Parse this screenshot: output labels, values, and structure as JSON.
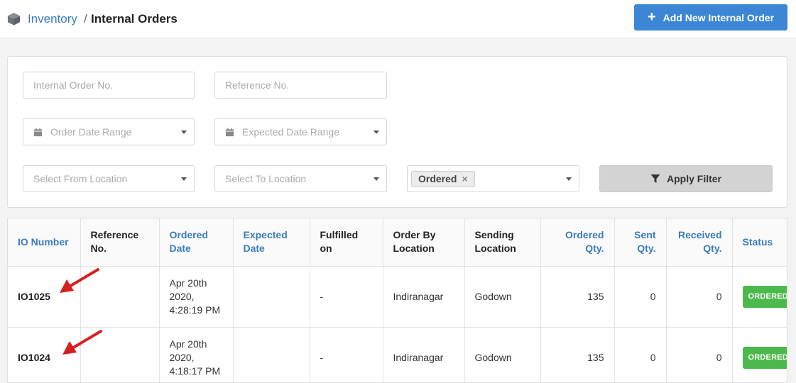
{
  "header": {
    "breadcrumb_root": "Inventory",
    "breadcrumb_separator": "/",
    "breadcrumb_current": "Internal Orders",
    "add_button_label": "Add New Internal Order",
    "breadcrumb_icon": "box-icon",
    "add_icon": "plus-icon"
  },
  "filters": {
    "io_number_placeholder": "Internal Order No.",
    "reference_placeholder": "Reference No.",
    "order_date_placeholder": "Order Date Range",
    "expected_date_placeholder": "Expected Date Range",
    "from_location_placeholder": "Select From Location",
    "to_location_placeholder": "Select To Location",
    "status_chip": "Ordered",
    "status_chip_remove": "×",
    "apply_label": "Apply Filter",
    "apply_icon": "filter-icon",
    "date_icon": "calendar-icon"
  },
  "table": {
    "columns": [
      "IO Number",
      "Reference No.",
      "Ordered Date",
      "Expected Date",
      "Fulfilled on",
      "Order By Location",
      "Sending Location",
      "Ordered Qty.",
      "Sent Qty.",
      "Received Qty.",
      "Status"
    ],
    "rows": [
      {
        "io_number": "IO1025",
        "reference": "",
        "ordered_date": "Apr 20th 2020, 4:28:19 PM",
        "expected_date": "",
        "fulfilled_on": "-",
        "order_by_location": "Indiranagar",
        "sending_location": "Godown",
        "ordered_qty": "135",
        "sent_qty": "0",
        "received_qty": "0",
        "status": "ORDERED"
      },
      {
        "io_number": "IO1024",
        "reference": "",
        "ordered_date": "Apr 20th 2020, 4:18:17 PM",
        "expected_date": "",
        "fulfilled_on": "-",
        "order_by_location": "Indiranagar",
        "sending_location": "Godown",
        "ordered_qty": "135",
        "sent_qty": "0",
        "received_qty": "0",
        "status": "ORDERED"
      }
    ]
  },
  "colors": {
    "accent": "#3b87d5",
    "link": "#3a7cc0",
    "status_ordered": "#4cb94c",
    "annotation_arrow": "#d62020"
  }
}
